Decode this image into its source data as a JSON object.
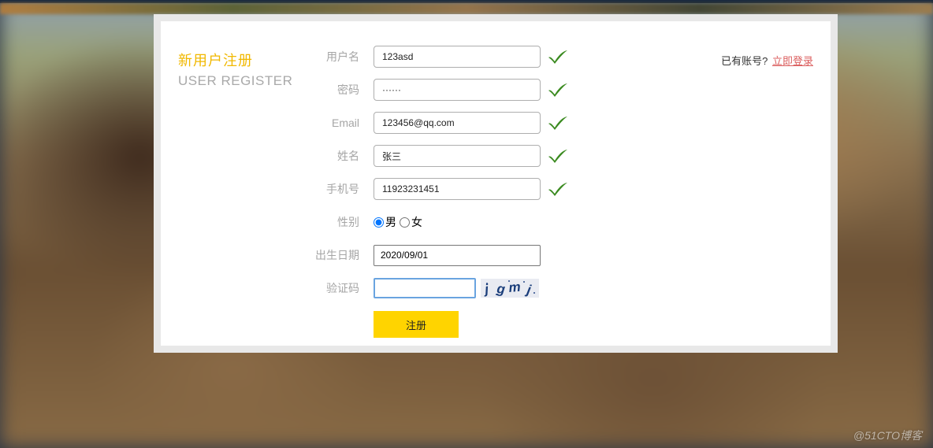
{
  "header": {
    "title_cn": "新用户注册",
    "title_en": "USER REGISTER"
  },
  "form": {
    "username": {
      "label": "用户名",
      "value": "123asd"
    },
    "password": {
      "label": "密码",
      "value": "······"
    },
    "email": {
      "label": "Email",
      "value": "123456@qq.com"
    },
    "name": {
      "label": "姓名",
      "value": "张三"
    },
    "phone": {
      "label": "手机号",
      "value": "11923231451"
    },
    "gender": {
      "label": "性别",
      "male": "男",
      "female": "女",
      "selected": "male"
    },
    "birth": {
      "label": "出生日期",
      "value": "2020/09/01"
    },
    "captcha": {
      "label": "验证码",
      "value": "",
      "image_text": "jgmj"
    },
    "submit": {
      "label": "注册"
    }
  },
  "side": {
    "has_account": "已有账号?",
    "login_link": "立即登录"
  },
  "watermark": "@51CTO博客",
  "colors": {
    "accent": "#f1b800",
    "button": "#ffd400",
    "link": "#db5e5e",
    "valid": "#3a8a1f"
  }
}
